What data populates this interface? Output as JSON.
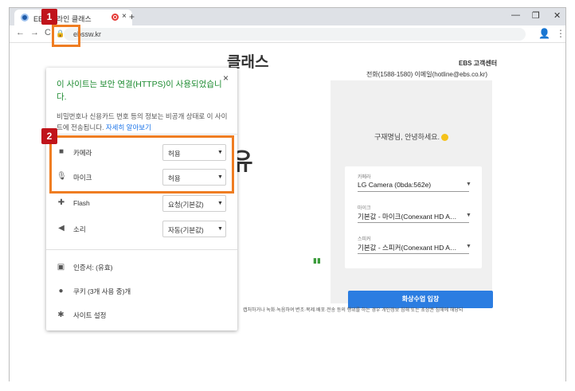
{
  "browser": {
    "tab_title": "EBS 온라인 클래스",
    "new_tab": "+",
    "tab_close": "×",
    "minimize": "—",
    "maximize": "❐",
    "close": "✕",
    "back": "←",
    "forward": "→",
    "reload": "C",
    "url": "ebssw.kr",
    "lock_icon": "🔒",
    "account_icon": "👤",
    "menu_icon": "⋮"
  },
  "page": {
    "brand": "클래스",
    "big_char": "유",
    "header_title": "EBS 고객센터",
    "header_contact": "전화(1588-1580) 이메일(hotline@ebs.co.kr)",
    "greeting": "구재명님, 안녕하세요.",
    "devices": [
      {
        "label": "카메라",
        "value": "LG Camera (0bda:562e)"
      },
      {
        "label": "마이크",
        "value": "기본값 - 마이크(Conexant HD A…"
      },
      {
        "label": "스피커",
        "value": "기본값 - 스피커(Conexant HD A…"
      }
    ],
    "join_button": "화상수업 입장",
    "footer": "캡처하거나 녹화·녹음하여 변조·복제·배포·전송 등의 행위를 하는 경우 개인정보 침해 또는 초상권 침해에 해당되"
  },
  "popup": {
    "title": "이 사이트는 보안 연결(HTTPS)이 사용되었습니다.",
    "description": "비밀번호나 신용카드 번호 등의 정보는 비공개 상태로 이 사이트에 전송됩니다.",
    "learn_more": "자세히 알아보기",
    "close": "×",
    "permissions": [
      {
        "label": "카메라",
        "value": "허용",
        "icon": "camera-icon"
      },
      {
        "label": "마이크",
        "value": "허용",
        "icon": "mic-icon"
      },
      {
        "label": "Flash",
        "value": "요청(기본값)",
        "icon": "puzzle-icon"
      },
      {
        "label": "소리",
        "value": "자동(기본값)",
        "icon": "speaker-icon"
      }
    ],
    "certificate": "인증서: (유효)",
    "cookies": "쿠키 (3개 사용 중)개",
    "site_settings": "사이트 설정"
  },
  "annotations": {
    "badge1": "1",
    "badge2": "2",
    "highlight_color": "#ef7d22",
    "badge_color": "#c0141b"
  }
}
